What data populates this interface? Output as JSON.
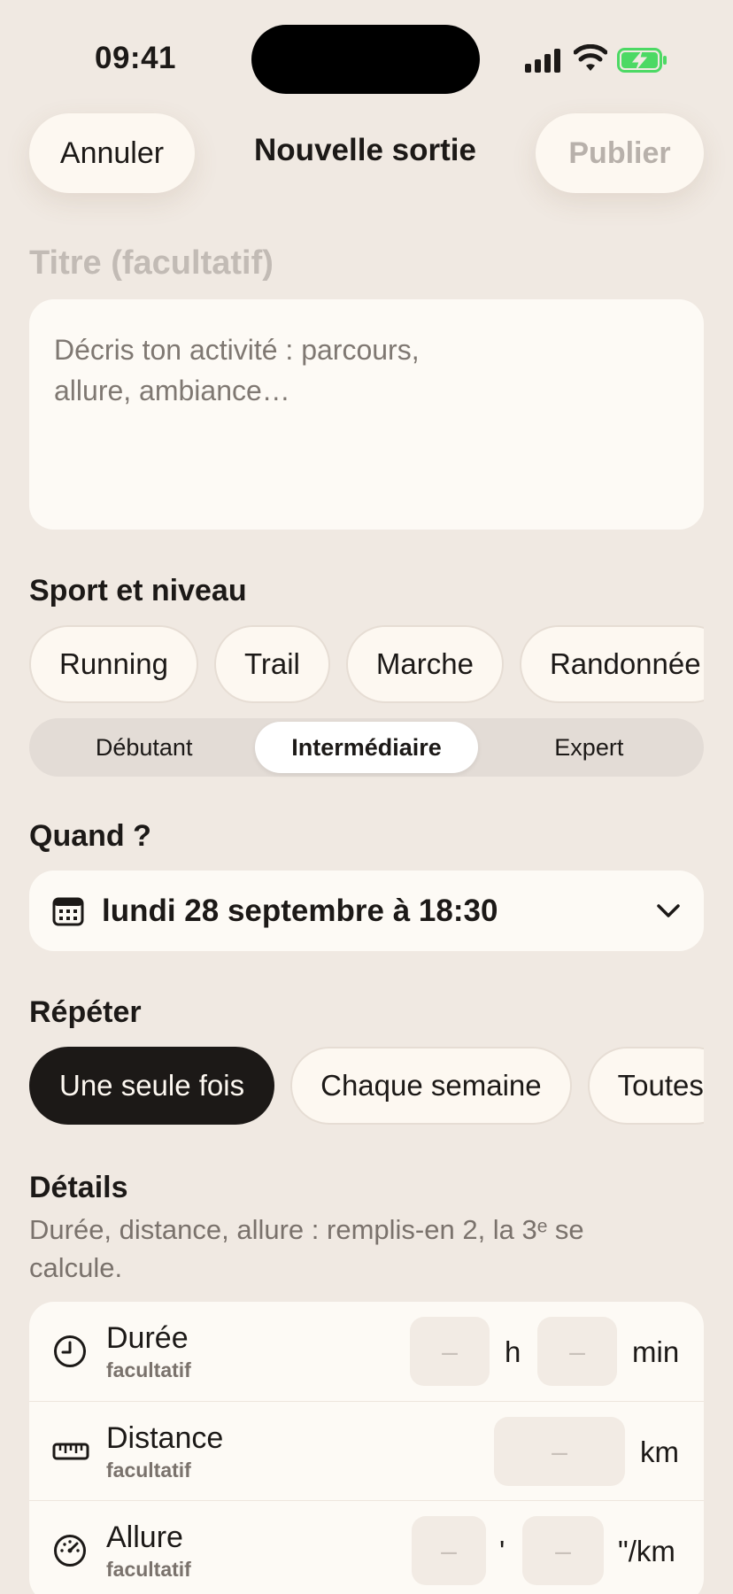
{
  "status_bar": {
    "time": "09:41"
  },
  "header": {
    "cancel_label": "Annuler",
    "title": "Nouvelle sortie",
    "publish_label": "Publier"
  },
  "form": {
    "title_placeholder": "Titre (facultatif)",
    "description_placeholder": "Décris ton activité : parcours,\nallure, ambiance…"
  },
  "sport_section": {
    "title": "Sport et niveau",
    "sports": [
      "Running",
      "Trail",
      "Marche",
      "Randonnée"
    ],
    "levels": [
      "Débutant",
      "Intermédiaire",
      "Expert"
    ],
    "selected_level": "Intermédiaire"
  },
  "when_section": {
    "title": "Quand ?",
    "date_value": "lundi 28 septembre à 18:30"
  },
  "repeat_section": {
    "title": "Répéter",
    "options": [
      "Une seule fois",
      "Chaque semaine",
      "Toutes"
    ],
    "selected": "Une seule fois"
  },
  "details_section": {
    "title": "Détails",
    "subtitle": "Durée, distance, allure : remplis-en 2, la 3ᵉ se calcule.",
    "rows": [
      {
        "label": "Durée",
        "sub": "facultatif",
        "icon": "clock-icon",
        "placeholders": [
          "–",
          "–"
        ],
        "units": [
          "h",
          "min"
        ]
      },
      {
        "label": "Distance",
        "sub": "facultatif",
        "icon": "ruler-icon",
        "placeholders": [
          "–"
        ],
        "units": [
          "km"
        ]
      },
      {
        "label": "Allure",
        "sub": "facultatif",
        "icon": "speedometer-icon",
        "placeholders": [
          "–",
          "–"
        ],
        "units": [
          "'",
          "\"/km"
        ]
      }
    ]
  },
  "colors": {
    "background": "#f0e9e2",
    "card": "#fdfaf5",
    "dark": "#1c1917",
    "muted": "#7a726c",
    "battery": "#4cd964"
  }
}
